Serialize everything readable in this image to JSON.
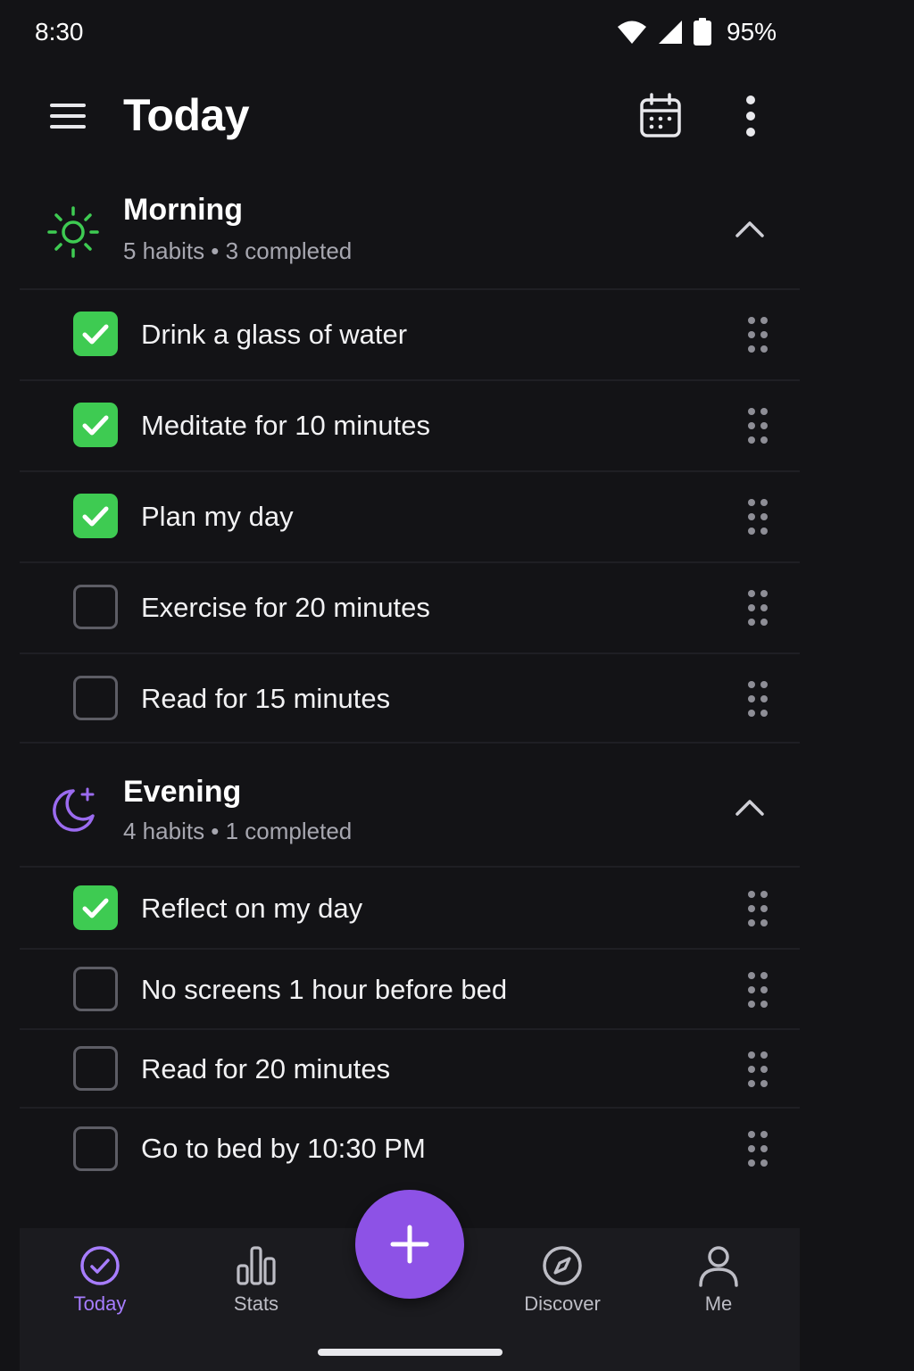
{
  "status_bar": {
    "time": "8:30",
    "battery": "95%"
  },
  "app_bar": {
    "title": "Today"
  },
  "colors": {
    "accent": "#8d52e6",
    "check_green": "#3ecb52",
    "morning_icon": "#3ecb52",
    "evening_icon": "#9b6bf0"
  },
  "sections": [
    {
      "title": "Morning",
      "subtitle": "5 habits • 3 completed",
      "icon": "sun-icon",
      "habits": [
        {
          "label": "Drink a glass of water",
          "completed": true
        },
        {
          "label": "Meditate for 10 minutes",
          "completed": true
        },
        {
          "label": "Plan my day",
          "completed": true
        },
        {
          "label": "Exercise for 20 minutes",
          "completed": false
        },
        {
          "label": "Read for 15 minutes",
          "completed": false
        }
      ]
    },
    {
      "title": "Evening",
      "subtitle": "4 habits • 1 completed",
      "icon": "moon-icon",
      "habits": [
        {
          "label": "Reflect on my day",
          "completed": true
        },
        {
          "label": "No screens 1 hour before bed",
          "completed": false
        },
        {
          "label": "Read for 20 minutes",
          "completed": false
        },
        {
          "label": "Go to bed by 10:30 PM",
          "completed": false
        }
      ]
    }
  ],
  "bottom_nav": {
    "items": [
      {
        "label": "Today",
        "icon": "check-circle-icon",
        "active": true
      },
      {
        "label": "Stats",
        "icon": "bar-chart-icon",
        "active": false
      },
      {
        "label": "Discover",
        "icon": "compass-icon",
        "active": false
      },
      {
        "label": "Me",
        "icon": "person-icon",
        "active": false
      }
    ],
    "fab_icon": "plus-icon"
  }
}
